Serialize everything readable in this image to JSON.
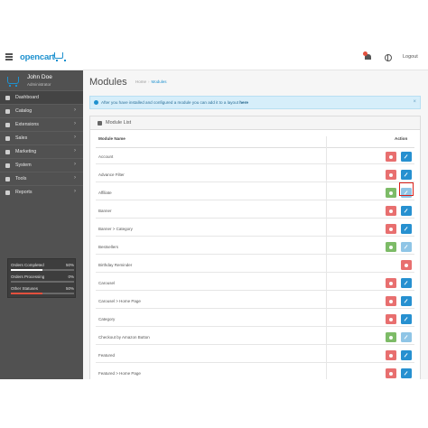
{
  "header": {
    "logo_text": "opencart",
    "logout_label": "Logout"
  },
  "profile": {
    "name": "John Doe",
    "role": "Administrator"
  },
  "nav": [
    {
      "label": "Dashboard",
      "icon": "dashboard-icon",
      "has_children": false,
      "active": true
    },
    {
      "label": "Catalog",
      "icon": "tag-icon",
      "has_children": true
    },
    {
      "label": "Extensions",
      "icon": "puzzle-icon",
      "has_children": true
    },
    {
      "label": "Sales",
      "icon": "cart-icon",
      "has_children": true
    },
    {
      "label": "Marketing",
      "icon": "share-icon",
      "has_children": true
    },
    {
      "label": "System",
      "icon": "cog-icon",
      "has_children": true
    },
    {
      "label": "Tools",
      "icon": "wrench-icon",
      "has_children": true
    },
    {
      "label": "Reports",
      "icon": "bar-chart-icon",
      "has_children": true
    }
  ],
  "stats": [
    {
      "label": "Orders Completed",
      "value": "50%",
      "fraction": 0.5,
      "color": "#ffffff"
    },
    {
      "label": "Orders Processing",
      "value": "0%",
      "fraction": 0.0,
      "color": "#ffffff"
    },
    {
      "label": "Other Statuses",
      "value": "50%",
      "fraction": 0.5,
      "color": "#e3503e"
    }
  ],
  "page": {
    "title": "Modules",
    "breadcrumb": [
      "Home",
      "Modules"
    ]
  },
  "alert": {
    "text": "After you have installed and configured a module you can add it to a layout ",
    "link": "here",
    "close": "×"
  },
  "panel": {
    "title": "Module List"
  },
  "table": {
    "headers": {
      "name": "Module Name",
      "action": "Action"
    },
    "rows": [
      {
        "name": "Account",
        "installed": true
      },
      {
        "name": "Advance Filter",
        "installed": true,
        "highlighted": true
      },
      {
        "name": "Affiliate",
        "installed": false
      },
      {
        "name": "Banner",
        "installed": true
      },
      {
        "name": "Banner > Category",
        "installed": true
      },
      {
        "name": "Bestsellers",
        "installed": false
      },
      {
        "name": "Birthday Reminder",
        "installed": true,
        "no_edit": true
      },
      {
        "name": "Carousel",
        "installed": true
      },
      {
        "name": "Carousel > Home Page",
        "installed": true
      },
      {
        "name": "Category",
        "installed": true
      },
      {
        "name": "Checkout by Amazon Button",
        "installed": false
      },
      {
        "name": "Featured",
        "installed": true
      },
      {
        "name": "Featured > Home Page",
        "installed": true
      }
    ]
  },
  "colors": {
    "uninstall": "#e86f6f",
    "install": "#7dbb67",
    "edit": "#2690d0",
    "edit_disabled": "#8fc5e6",
    "highlight": "#d9201a"
  }
}
